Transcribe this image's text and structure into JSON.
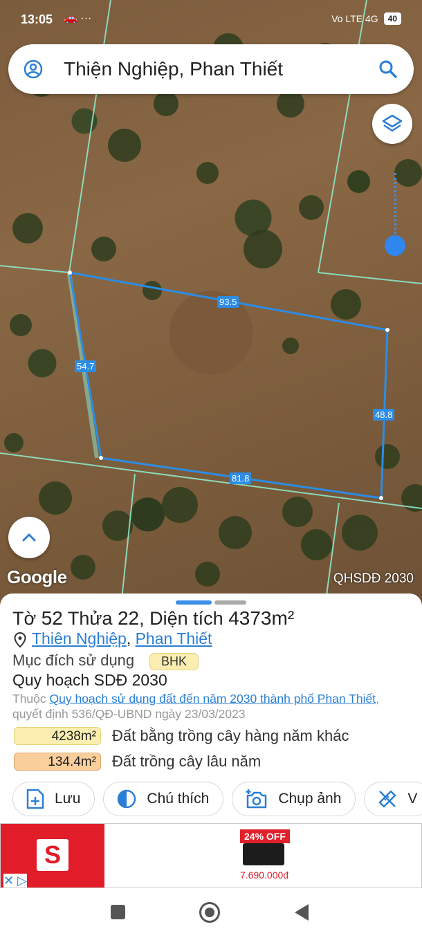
{
  "status_bar": {
    "time": "13:05",
    "extra_icons": "🚗 ···",
    "signal": "Vo LTE 4G",
    "battery": "40"
  },
  "search": {
    "query": "Thiện Nghiệp, Phan Thiết"
  },
  "map": {
    "edges": {
      "top": "93.5",
      "left": "54.7",
      "right": "48.8",
      "bottom": "81.8"
    },
    "google_logo": "Google",
    "layer_tag": "QHSDĐ 2030"
  },
  "parcel": {
    "title_prefix": "Tờ ",
    "sheet_no": "52",
    "title_mid": " Thửa ",
    "plot_no": "22",
    "title_area_label": ", Diện tích ",
    "area": "4373m²",
    "location_link1": "Thiên Nghiệp",
    "location_sep": ", ",
    "location_link2": "Phan Thiết",
    "purpose_label": "Mục đích sử dụng",
    "purpose_code": "BHK",
    "plan_title": "Quy hoạch SDĐ 2030",
    "plan_prefix": "Thuộc ",
    "plan_link": "Quy hoạch sử dụng đất đến năm 2030 thành phố Phan Thiết",
    "plan_suffix": ", quyết định 536/QĐ-UBND ngày 23/03/2023",
    "areas": [
      {
        "value": "4238m²",
        "label": "Đất bằng trồng cây hàng năm khác",
        "color": "#fbeeb0"
      },
      {
        "value": "134.4m²",
        "label": "Đất trồng cây lâu năm",
        "color": "#fbcf9c"
      }
    ]
  },
  "actions": [
    {
      "label": "Lưu",
      "icon": "add-file-icon"
    },
    {
      "label": "Chú thích",
      "icon": "half-circle-icon"
    },
    {
      "label": "Chụp ảnh",
      "icon": "add-photo-icon"
    },
    {
      "label": "V",
      "icon": "ruler-pencil-icon"
    }
  ],
  "ad": {
    "badge": "24% OFF",
    "price": "7.690.000đ",
    "close": "✕ ▷"
  }
}
